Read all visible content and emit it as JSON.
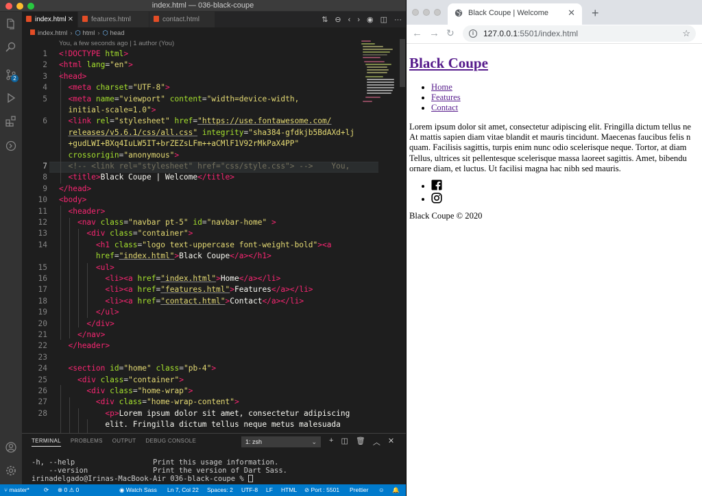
{
  "vscode": {
    "window_title": "index.html — 036-black-coupe",
    "tabs": [
      {
        "label": "index.html",
        "active": true
      },
      {
        "label": "features.html",
        "active": false
      },
      {
        "label": "contact.html",
        "active": false
      }
    ],
    "breadcrumb": [
      "index.html",
      "html",
      "head"
    ],
    "codelens": "You, a few seconds ago | 1 author (You)",
    "scm_badge": "2",
    "line_numbers": [
      "1",
      "2",
      "3",
      "4",
      "5",
      "",
      "6",
      "",
      "",
      "",
      "7",
      "8",
      "9",
      "10",
      "11",
      "12",
      "13",
      "14",
      "",
      "15",
      "16",
      "17",
      "18",
      "19",
      "20",
      "21",
      "22",
      "23",
      "24",
      "25",
      "26",
      "27",
      "28",
      ""
    ],
    "current_line": "7",
    "blame_inline": "You,",
    "panel": {
      "tabs": [
        "TERMINAL",
        "PROBLEMS",
        "OUTPUT",
        "DEBUG CONSOLE"
      ],
      "active_tab": "TERMINAL",
      "shell_select": "1: zsh",
      "terminal_lines": [
        "-h, --help                  Print this usage information.",
        "    --version               Print the version of Dart Sass.",
        "irinadelgado@Irinas-MacBook-Air 036-black-coupe % "
      ]
    },
    "status": {
      "branch": "master*",
      "problems": "⊗ 0 ⚠ 0",
      "watch_sass": "Watch Sass",
      "position": "Ln 7, Col 22",
      "spaces": "Spaces: 2",
      "encoding": "UTF-8",
      "eol": "LF",
      "language": "HTML",
      "port": "Port : 5501",
      "formatter": "Prettier"
    }
  },
  "browser": {
    "tab_title": "Black Coupe | Welcome",
    "url_host": "127.0.0.1",
    "url_rest": ":5501/index.html",
    "page": {
      "heading": "Black Coupe",
      "nav_links": [
        "Home",
        "Features",
        "Contact"
      ],
      "lorem_lines": [
        "Lorem ipsum dolor sit amet, consectetur adipiscing elit. Fringilla dictum tellus ne",
        "At mattis sapien diam vitae blandit et mauris tincidunt. Maecenas faucibus felis n",
        "quam. Facilisis sagittis, turpis enim nunc odio scelerisque neque. Tortor, at diam",
        "Tellus, ultrices sit pellentesque scelerisque massa laoreet sagittis. Amet, bibendu",
        "ornare diam, et luctus. Ut facilisi magna hac nibh sed mauris."
      ],
      "social_icons": [
        "facebook-icon",
        "instagram-icon"
      ],
      "footer": "Black Coupe © 2020"
    }
  },
  "colors": {
    "vscode_bg": "#1e1e1e",
    "statusbar": "#007acc",
    "tag": "#f92672",
    "attr": "#a6e22e",
    "string": "#e6db74",
    "comment": "#75715e",
    "visited_link": "#551a8b"
  }
}
